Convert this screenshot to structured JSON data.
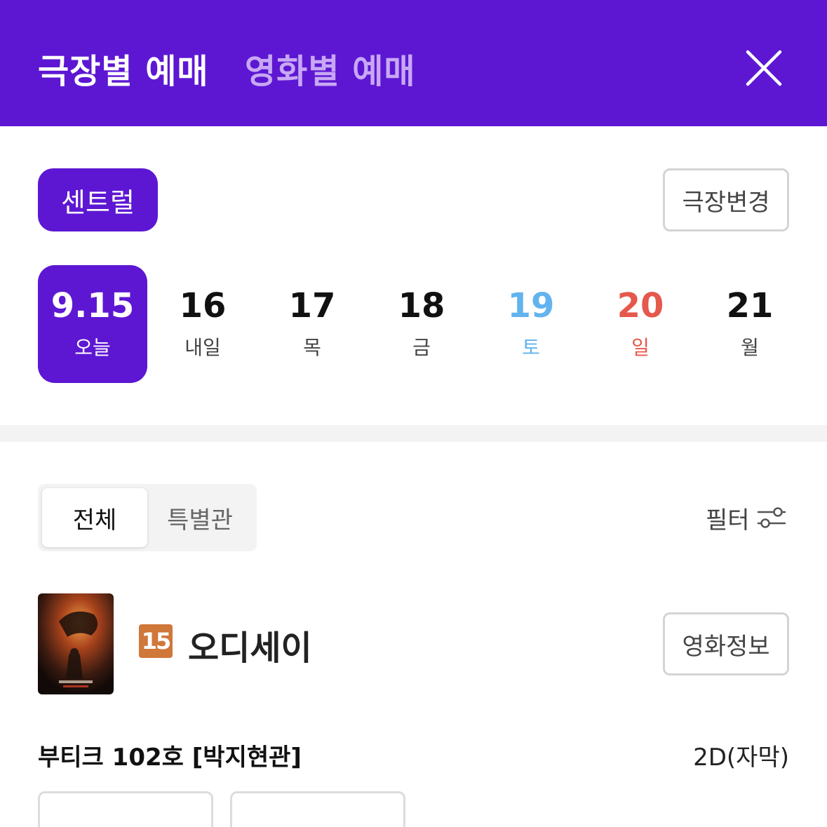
{
  "header": {
    "tab_theater": "극장별 예매",
    "tab_movie": "영화별 예매",
    "close_icon": "close-icon",
    "background_color": "#5d17d3"
  },
  "theater": {
    "selected": "센트럴",
    "change_button": "극장변경"
  },
  "dates": [
    {
      "num": "9.15",
      "dow": "오늘",
      "state": "active"
    },
    {
      "num": "16",
      "dow": "내일",
      "state": "weekday"
    },
    {
      "num": "17",
      "dow": "목",
      "state": "weekday"
    },
    {
      "num": "18",
      "dow": "금",
      "state": "weekday"
    },
    {
      "num": "19",
      "dow": "토",
      "state": "saturday",
      "color": "#63b3ee"
    },
    {
      "num": "20",
      "dow": "일",
      "state": "sunday",
      "color": "#e5584c"
    },
    {
      "num": "21",
      "dow": "월",
      "state": "weekday"
    }
  ],
  "segment": {
    "all": "전체",
    "special": "특별관",
    "selected": "전체"
  },
  "filter": {
    "label": "필터",
    "icon": "sliders-icon"
  },
  "movie": {
    "age_rating": "15",
    "title": "오디세이",
    "info_button": "영화정보",
    "poster_icon": "movie-poster"
  },
  "screen": {
    "hall": "부티크 102호 [박지현관]",
    "format": "2D(자막)"
  }
}
